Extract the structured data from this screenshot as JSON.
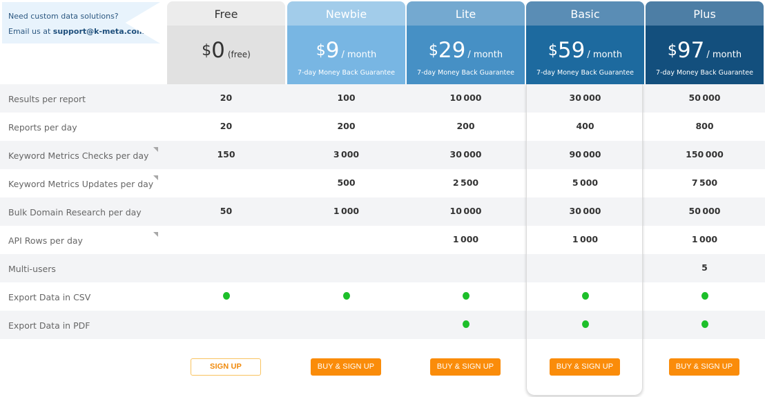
{
  "promo": {
    "line1": "Need custom data solutions?",
    "line2_prefix": "Email us at ",
    "email": "support@k-meta.com"
  },
  "colors": {
    "accent_button": "#fa8c0a",
    "check_dot": "#1dbf2a",
    "row_alt": "#f3f4f6"
  },
  "plans": [
    {
      "name": "Free",
      "currency": "$",
      "amount": "0",
      "period": "(free)",
      "guarantee": "",
      "button": "SIGN UP",
      "name_bg": "#ececec",
      "price_bg": "#e1e1e1",
      "text_color": "#333333"
    },
    {
      "name": "Newbie",
      "currency": "$",
      "amount": "9",
      "period": "/ month",
      "guarantee": "7-day Money Back Guarantee",
      "button": "BUY & SIGN UP",
      "name_bg": "#a2ccea",
      "price_bg": "#78b6e3",
      "text_color": "#ffffff"
    },
    {
      "name": "Lite",
      "currency": "$",
      "amount": "29",
      "period": "/ month",
      "guarantee": "7-day Money Back Guarantee",
      "button": "BUY & SIGN UP",
      "name_bg": "#74a9d0",
      "price_bg": "#4690c5",
      "text_color": "#ffffff"
    },
    {
      "name": "Basic",
      "currency": "$",
      "amount": "59",
      "period": "/ month",
      "guarantee": "7-day Money Back Guarantee",
      "button": "BUY & SIGN UP",
      "name_bg": "#5a8db5",
      "price_bg": "#1d6a9f",
      "text_color": "#ffffff"
    },
    {
      "name": "Plus",
      "currency": "$",
      "amount": "97",
      "period": "/ month",
      "guarantee": "7-day Money Back Guarantee",
      "button": "BUY & SIGN UP",
      "name_bg": "#4d7ea5",
      "price_bg": "#134f7d",
      "text_color": "#ffffff"
    }
  ],
  "features": [
    {
      "label": "Results per report",
      "info": false,
      "values": [
        "20",
        "100",
        "10000",
        "30000",
        "50000"
      ]
    },
    {
      "label": "Reports per day",
      "info": false,
      "values": [
        "20",
        "200",
        "200",
        "400",
        "800"
      ]
    },
    {
      "label": "Keyword Metrics Checks per day",
      "info": true,
      "values": [
        "150",
        "3000",
        "30000",
        "90000",
        "150000"
      ]
    },
    {
      "label": "Keyword Metrics Updates per day",
      "info": true,
      "values": [
        "",
        "500",
        "2500",
        "5000",
        "7500"
      ]
    },
    {
      "label": "Bulk Domain Research per day",
      "info": false,
      "values": [
        "50",
        "1000",
        "10000",
        "30000",
        "50000"
      ]
    },
    {
      "label": "API Rows per day",
      "info": true,
      "values": [
        "",
        "",
        "1000",
        "1000",
        "1000"
      ]
    },
    {
      "label": "Multi-users",
      "info": false,
      "values": [
        "",
        "",
        "",
        "",
        "5"
      ]
    },
    {
      "label": "Export Data in CSV",
      "info": false,
      "values": [
        "check",
        "check",
        "check",
        "check",
        "check"
      ]
    },
    {
      "label": "Export Data in PDF",
      "info": false,
      "values": [
        "",
        "",
        "check",
        "check",
        "check"
      ]
    }
  ]
}
